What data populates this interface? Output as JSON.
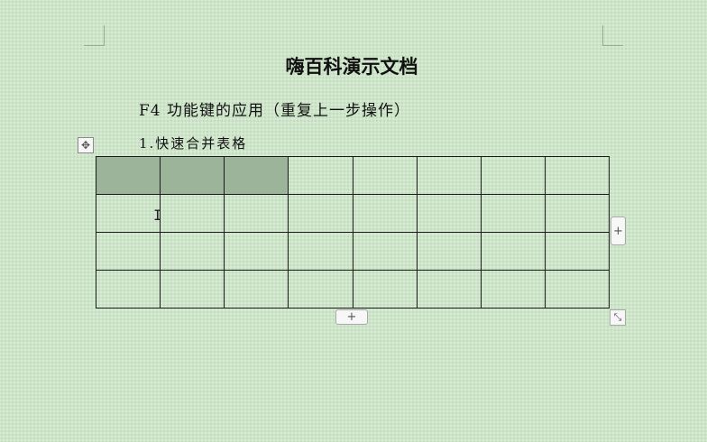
{
  "document": {
    "title": "嗨百科演示文档",
    "subtitle": "F4  功能键的应用（重复上一步操作）",
    "section_heading": "1.快速合并表格"
  },
  "table": {
    "rows": 4,
    "cols": 8,
    "selected_cells": [
      [
        0,
        0
      ],
      [
        0,
        1
      ],
      [
        0,
        2
      ]
    ],
    "selection_color": "#9cb59a"
  },
  "controls": {
    "move_handle_icon": "move-arrows-icon",
    "add_column_symbol": "+",
    "add_row_symbol": "+",
    "resize_handle_icon": "resize-diagonal-icon"
  },
  "colors": {
    "page_background": "#cfe6cb",
    "text": "#111111",
    "table_border": "#1b1b1b"
  }
}
